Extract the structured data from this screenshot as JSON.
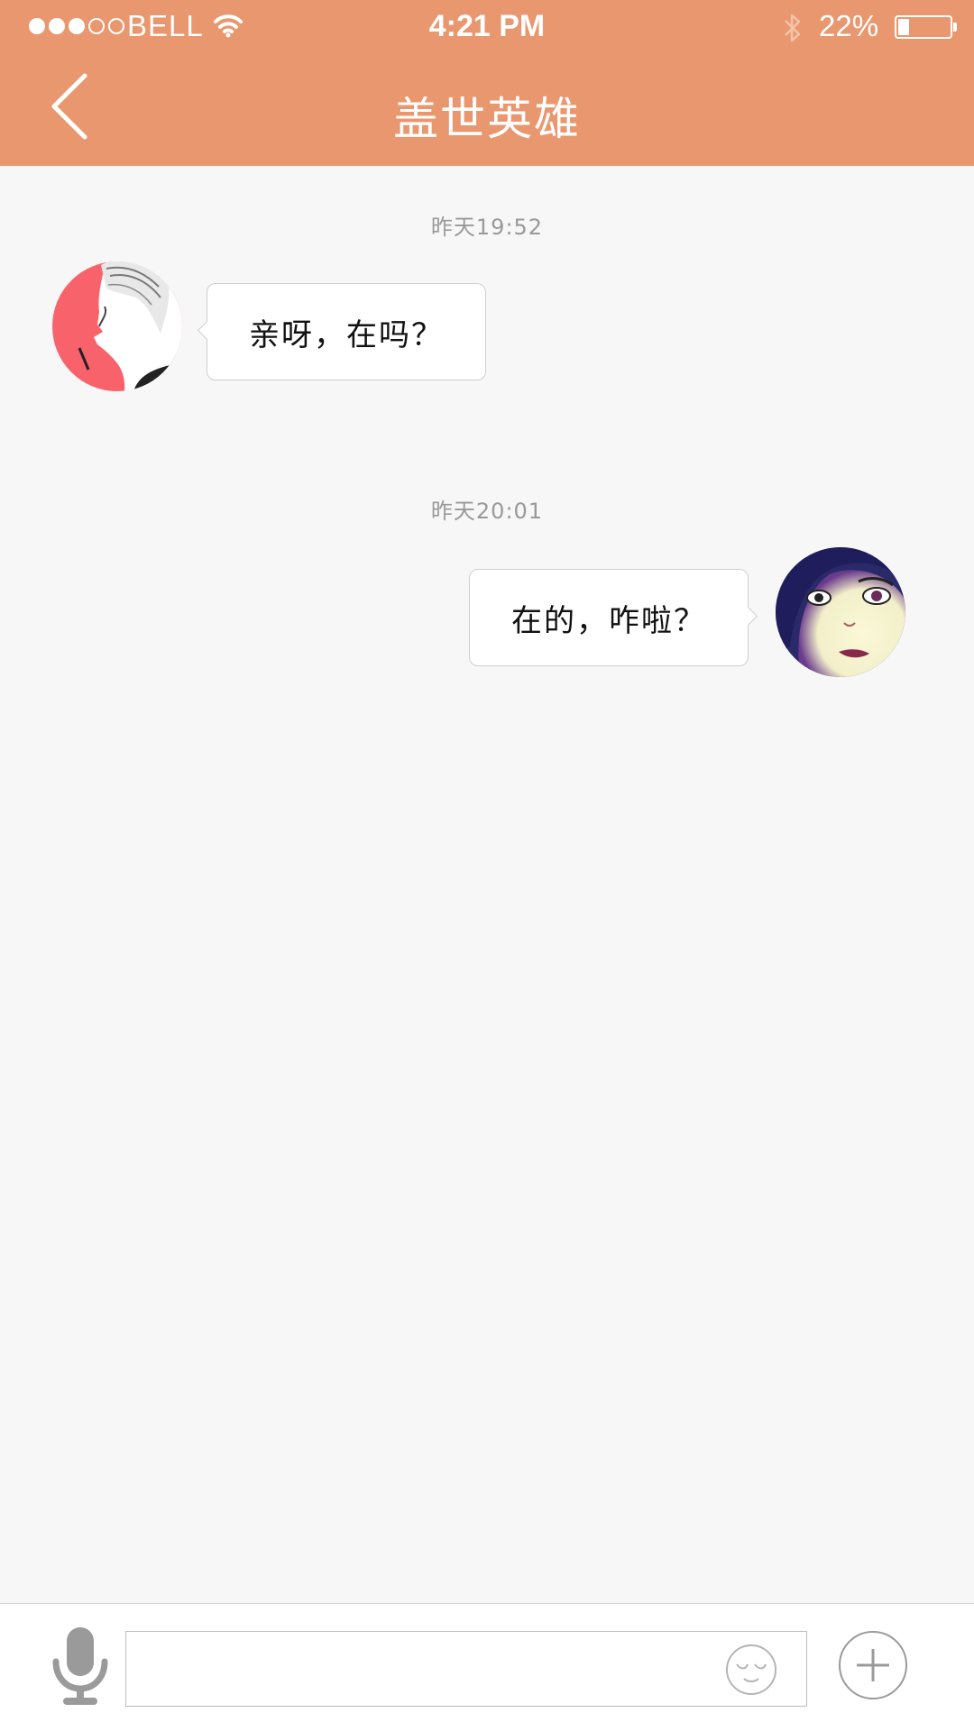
{
  "status_bar": {
    "carrier": "BELL",
    "time": "4:21 PM",
    "battery_percent": "22%",
    "battery_level": 0.22,
    "signal_bars": 3,
    "signal_total": 5
  },
  "nav": {
    "title": "盖世英雄",
    "back_icon": "chevron-left-icon"
  },
  "messages": [
    {
      "timestamp": "昨天19:52",
      "side": "left",
      "text": "亲呀，在吗？"
    },
    {
      "timestamp": "昨天20:01",
      "side": "right",
      "text": "在的，咋啦？"
    }
  ],
  "input_bar": {
    "value": "",
    "placeholder": "",
    "icons": [
      "microphone-icon",
      "emoji-icon",
      "plus-icon"
    ]
  },
  "colors": {
    "header": "#e9976e",
    "background": "#f7f7f7",
    "timestamp": "#999999"
  }
}
